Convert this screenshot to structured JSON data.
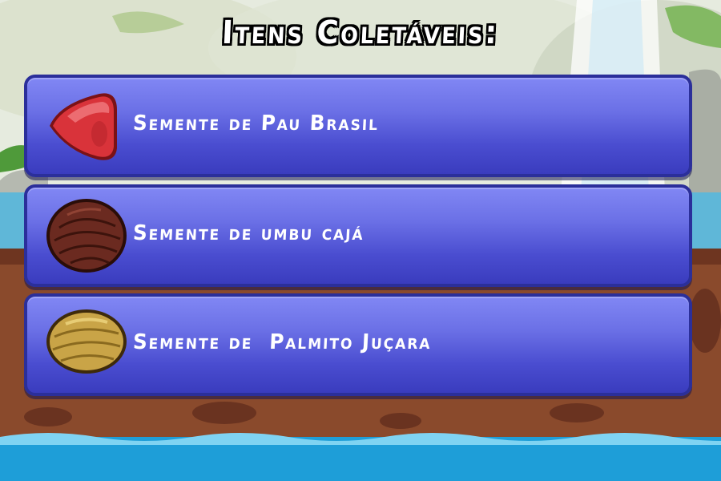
{
  "title": "Itens Coletáveis:",
  "items": [
    {
      "label": "Semente de Pau Brasil",
      "icon": "red-seed-icon",
      "color": "#d9333a"
    },
    {
      "label": "Semente de umbu cajá",
      "icon": "brown-seed-icon",
      "color": "#6b2a20"
    },
    {
      "label": "Semente de  Palmito Juçara",
      "icon": "golden-seed-icon",
      "color": "#c9a447"
    }
  ],
  "colors": {
    "panel_top": "#8187f4",
    "panel_bottom": "#3a3cbe",
    "panel_border": "#2b2f9a",
    "water": "#1e9ed8",
    "soil": "#8a4a2c"
  }
}
